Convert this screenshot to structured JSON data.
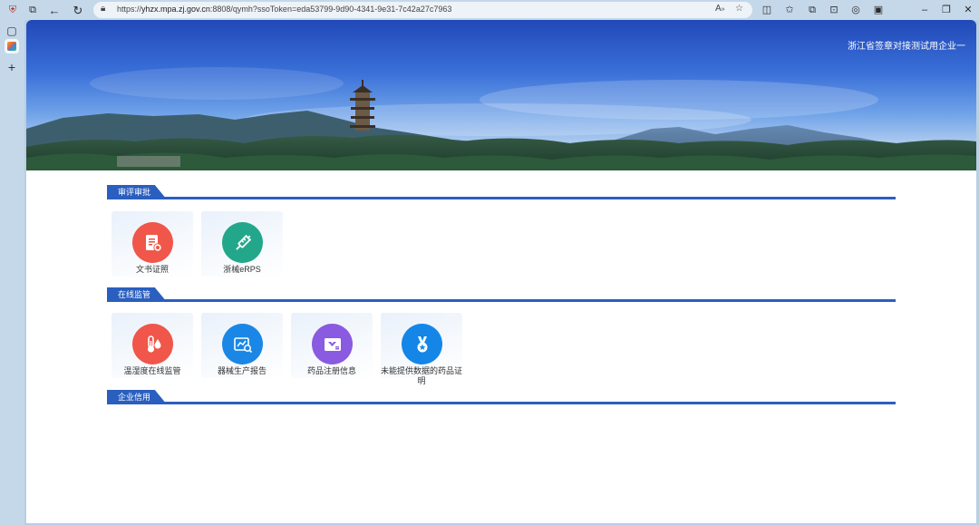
{
  "browser": {
    "url_prefix": "https://",
    "url_domain": "yhzx.mpa.zj.gov.cn",
    "url_rest": ":8808/qymh?ssoToken=eda53799-9d90-4341-9e31-7c42a27c7963",
    "reader_icon": "read-aloud-icon"
  },
  "header": {
    "user_name": "浙江省签章对接测试用企业一"
  },
  "sections": [
    {
      "title": "审评审批",
      "items": [
        {
          "label": "文书证照",
          "icon": "certificate-icon",
          "color": "#f0564a"
        },
        {
          "label": "浙械eRPS",
          "icon": "syringe-icon",
          "color": "#23a78a"
        }
      ]
    },
    {
      "title": "在线监管",
      "items": [
        {
          "label": "温湿度在线监管",
          "icon": "thermometer-icon",
          "color": "#f0564a"
        },
        {
          "label": "器械生产报告",
          "icon": "report-icon",
          "color": "#1a87e6"
        },
        {
          "label": "药品注册信息",
          "icon": "registration-icon",
          "color": "#8a5ae0"
        },
        {
          "label": "未能提供数据的药品证明",
          "icon": "medal-icon",
          "color": "#1486e8"
        }
      ]
    },
    {
      "title": "企业信用",
      "items": []
    }
  ]
}
